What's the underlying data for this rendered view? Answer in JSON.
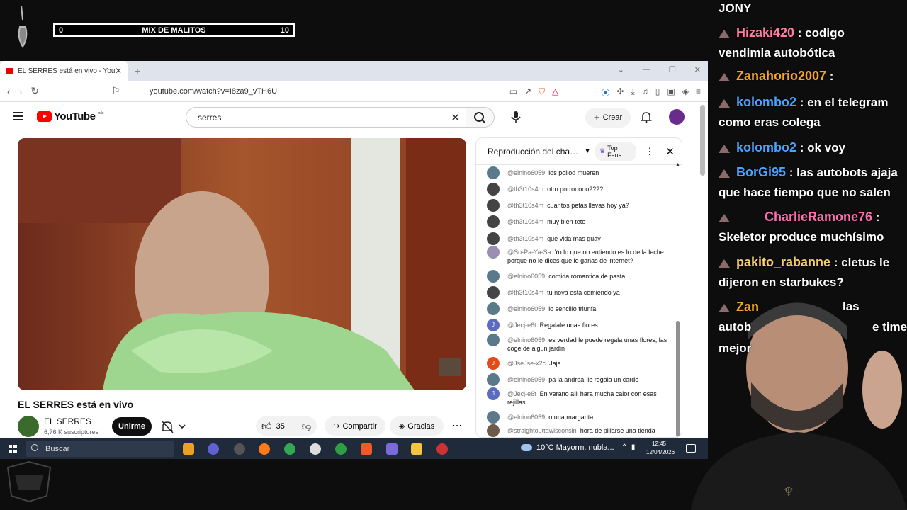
{
  "overlay": {
    "bar": {
      "left": "0",
      "title": "MIX DE MALITOS",
      "right": "10"
    }
  },
  "browser": {
    "tab_title": "EL SERRES está en vivo - YouTube",
    "url": "youtube.com/watch?v=I8za9_vTH6U"
  },
  "youtube": {
    "region": "ES",
    "logo": "YouTube",
    "search_value": "serres",
    "create_label": "Crear",
    "video_title": "EL SERRES está en vivo",
    "channel_name": "EL SERRES",
    "subscribers": "6,76 K suscriptores",
    "join_label": "Unirme",
    "likes": "35",
    "share_label": "Compartir",
    "thanks_label": "Gracias"
  },
  "live_chat": {
    "title": "Reproducción del chat d...",
    "filter": "Top Fans",
    "messages": [
      {
        "user": "@elnino6059",
        "text": "los pollod mueren",
        "avatar_color": "#5a7a8c"
      },
      {
        "user": "@th3t10s4m",
        "text": "otro porrooooo????",
        "avatar_color": "#444"
      },
      {
        "user": "@th3t10s4m",
        "text": "cuantos petas llevas hoy ya?",
        "avatar_color": "#444"
      },
      {
        "user": "@th3t10s4m",
        "text": "muy bien tete",
        "avatar_color": "#444"
      },
      {
        "user": "@th3t10s4m",
        "text": "que vida mas guay",
        "avatar_color": "#444"
      },
      {
        "user": "@So-Pa-Ya-Sa",
        "text": "Yo lo que no entiendo es lo de la leche.. porque no le dices que lo ganas de internet?",
        "avatar_color": "#9a8fb0"
      },
      {
        "user": "@elnino6059",
        "text": "comida romantica de pasta",
        "avatar_color": "#5a7a8c"
      },
      {
        "user": "@th3t10s4m",
        "text": "tu nova esta comiendo ya",
        "avatar_color": "#444"
      },
      {
        "user": "@elnino6059",
        "text": "lo sencillo triunfa",
        "avatar_color": "#5a7a8c"
      },
      {
        "user": "@Jecj-e6t",
        "text": "Regalale unas flores",
        "avatar_color": "#5c6bc0",
        "initial": "J"
      },
      {
        "user": "@elnino6059",
        "text": "es verdad le puede regala unas flores, las coge de algun jardin",
        "avatar_color": "#5a7a8c"
      },
      {
        "user": "@JseJse-x2c",
        "text": "Jaja",
        "avatar_color": "#e64a19",
        "initial": "J"
      },
      {
        "user": "@elnino6059",
        "text": "pa la andrea, le regala un cardo",
        "avatar_color": "#5a7a8c"
      },
      {
        "user": "@Jecj-e6t",
        "text": "En verano alli hara mucha calor con esas rejillas",
        "avatar_color": "#5c6bc0",
        "initial": "J"
      },
      {
        "user": "@elnino6059",
        "text": "o una margarita",
        "avatar_color": "#5a7a8c"
      },
      {
        "user": "@straightouttawisconsin",
        "text": "hora de pillarse una tienda",
        "avatar_color": "#6d5a4a"
      }
    ]
  },
  "taskbar": {
    "search_placeholder": "Buscar",
    "weather": "10°C  Mayorm. nubla...",
    "time": "12:45",
    "date": "12/04/2026"
  },
  "stream_chat": {
    "lines": [
      {
        "user": "",
        "text": "JONY",
        "user_color": "#ffffff"
      },
      {
        "user": "Hizaki420",
        "text": " : codigo",
        "user_color": "#ff7fa3"
      },
      {
        "user": "",
        "text": "vendimia autobótica",
        "user_color": "#ffffff"
      },
      {
        "user": "Zanahorio2007",
        "text": " :",
        "user_color": "#f5a524"
      },
      {
        "user": "kolombo2",
        "text": " : en el telegram",
        "user_color": "#4aa3ff"
      },
      {
        "user": "",
        "text": "como eras colega",
        "user_color": "#ffffff"
      },
      {
        "user": "kolombo2",
        "text": " : ok voy",
        "user_color": "#4aa3ff"
      },
      {
        "user": "BorGi95",
        "text": " : las autobots ajaja",
        "user_color": "#4aa3ff"
      },
      {
        "user": "",
        "text": "que hace tiempo que no salen",
        "user_color": "#ffffff"
      },
      {
        "user": "CharlieRamone76",
        "text": " :",
        "user_color": "#ff6fb0"
      },
      {
        "user": "",
        "text": "Skeletor produce muchísimo",
        "user_color": "#ffffff"
      },
      {
        "user": "pakito_rabanne",
        "text": " : cletus le",
        "user_color": "#f5d06a"
      },
      {
        "user": "",
        "text": "dijeron en starbukcs?",
        "user_color": "#ffffff"
      },
      {
        "user": "Zan",
        "text": "",
        "user_color": "#f5a524"
      },
      {
        "user": "",
        "text": "las",
        "user_color": "#ffffff"
      },
      {
        "user": "",
        "text": "autob",
        "user_color": "#ffffff"
      },
      {
        "user": "",
        "text": "e time",
        "user_color": "#ffffff"
      },
      {
        "user": "",
        "text": "mejor",
        "user_color": "#ffffff"
      }
    ]
  }
}
